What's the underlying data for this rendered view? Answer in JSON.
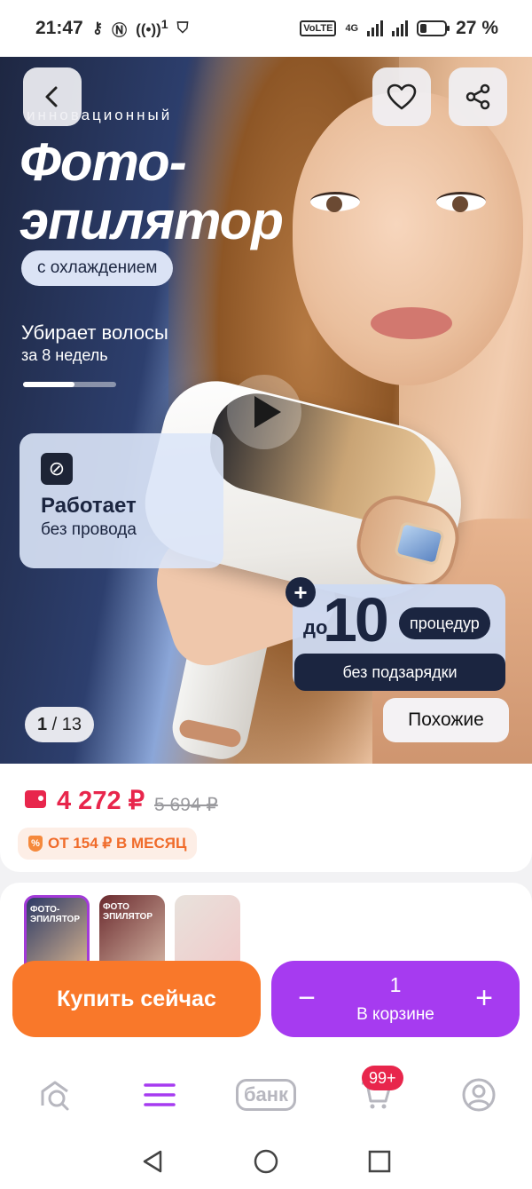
{
  "status_bar": {
    "time": "21:47",
    "battery": "27 %",
    "network": "4G",
    "volte": "VoLTE",
    "notification_count": "1",
    "icons": [
      "key-icon",
      "nfc-icon",
      "hotspot-icon",
      "shield-app-icon",
      "volte-icon",
      "signal-icon",
      "battery-icon"
    ]
  },
  "hero": {
    "tagline": "инновационный",
    "title_line1": "Фото-",
    "title_line2": "эпилятор",
    "cooling_pill": "с охлаждением",
    "removes_title": "Убирает волосы",
    "removes_sub": "за 8 недель",
    "removes_progress": 0.55,
    "wireless_title": "Работает",
    "wireless_sub": "без провода",
    "proc_prefix": "до",
    "proc_number": "10",
    "proc_word": "процедур",
    "proc_bottom": "без подзарядки",
    "counter_current": "1",
    "counter_total": "/ 13",
    "similar_label": "Похожие",
    "icons": [
      "back-arrow-icon",
      "heart-icon",
      "share-icon",
      "play-icon",
      "no-wire-icon",
      "plus-icon"
    ]
  },
  "price": {
    "current": "4 272 ₽",
    "old": "5 694 ₽",
    "installment": "ОТ 154 ₽ В МЕСЯЦ",
    "colors": {
      "accent": "#e8264c",
      "installment": "#f06b2a"
    }
  },
  "thumbnails": [
    {
      "label": "ФОТО-ЭПИЛЯТОР",
      "selected": true
    },
    {
      "label": "ФОТО ЭПИЛЯТОР",
      "selected": false
    },
    {
      "label": "",
      "selected": false
    }
  ],
  "actions": {
    "buy_label": "Купить сейчас",
    "qty_minus": "−",
    "qty_plus": "+",
    "qty_value": "1",
    "qty_label": "В корзине",
    "colors": {
      "buy": "#f9782a",
      "cart": "#a63bf0"
    }
  },
  "bottom_nav": {
    "bank_label": "банк",
    "cart_badge": "99+",
    "icons": [
      "home-search-icon",
      "catalog-menu-icon",
      "bank-icon",
      "cart-icon",
      "profile-icon"
    ]
  },
  "system_nav": {
    "icons": [
      "back-triangle-icon",
      "home-circle-icon",
      "recent-square-icon"
    ]
  }
}
